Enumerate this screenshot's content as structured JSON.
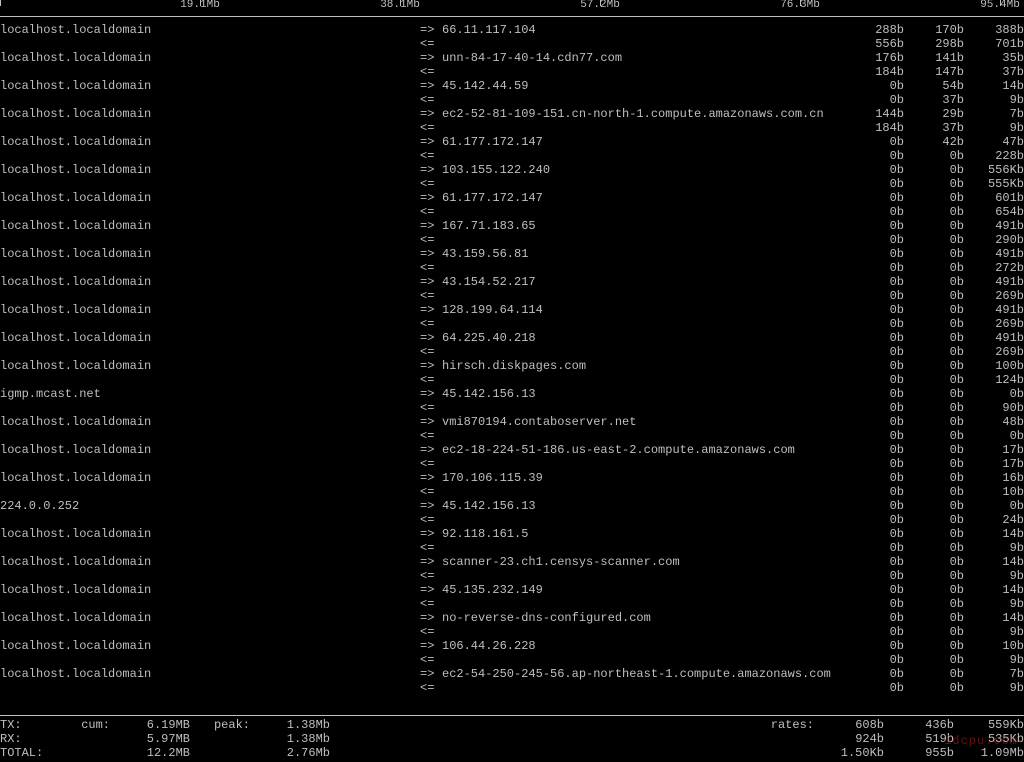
{
  "scale_ticks": [
    {
      "pos": 0,
      "label": ""
    },
    {
      "pos": 200,
      "label": "19.1Mb"
    },
    {
      "pos": 400,
      "label": "38.1Mb"
    },
    {
      "pos": 600,
      "label": "57.2Mb"
    },
    {
      "pos": 800,
      "label": "76.3Mb"
    },
    {
      "pos": 1000,
      "label": "95.4Mb"
    }
  ],
  "connections": [
    {
      "src": "localhost.localdomain",
      "dst": "66.11.117.104",
      "tx": [
        "288b",
        "170b",
        "388b"
      ],
      "rx": [
        "556b",
        "298b",
        "701b"
      ]
    },
    {
      "src": "localhost.localdomain",
      "dst": "unn-84-17-40-14.cdn77.com",
      "tx": [
        "176b",
        "141b",
        "35b"
      ],
      "rx": [
        "184b",
        "147b",
        "37b"
      ]
    },
    {
      "src": "localhost.localdomain",
      "dst": "45.142.44.59",
      "tx": [
        "0b",
        "54b",
        "14b"
      ],
      "rx": [
        "0b",
        "37b",
        "9b"
      ]
    },
    {
      "src": "localhost.localdomain",
      "dst": "ec2-52-81-109-151.cn-north-1.compute.amazonaws.com.cn",
      "tx": [
        "144b",
        "29b",
        "7b"
      ],
      "rx": [
        "184b",
        "37b",
        "9b"
      ]
    },
    {
      "src": "localhost.localdomain",
      "dst": "61.177.172.147",
      "tx": [
        "0b",
        "42b",
        "47b"
      ],
      "rx": [
        "0b",
        "0b",
        "228b"
      ]
    },
    {
      "src": "localhost.localdomain",
      "dst": "103.155.122.240",
      "tx": [
        "0b",
        "0b",
        "556Kb"
      ],
      "rx": [
        "0b",
        "0b",
        "555Kb"
      ]
    },
    {
      "src": "localhost.localdomain",
      "dst": "61.177.172.147",
      "tx": [
        "0b",
        "0b",
        "601b"
      ],
      "rx": [
        "0b",
        "0b",
        "654b"
      ]
    },
    {
      "src": "localhost.localdomain",
      "dst": "167.71.183.65",
      "tx": [
        "0b",
        "0b",
        "491b"
      ],
      "rx": [
        "0b",
        "0b",
        "290b"
      ]
    },
    {
      "src": "localhost.localdomain",
      "dst": "43.159.56.81",
      "tx": [
        "0b",
        "0b",
        "491b"
      ],
      "rx": [
        "0b",
        "0b",
        "272b"
      ]
    },
    {
      "src": "localhost.localdomain",
      "dst": "43.154.52.217",
      "tx": [
        "0b",
        "0b",
        "491b"
      ],
      "rx": [
        "0b",
        "0b",
        "269b"
      ]
    },
    {
      "src": "localhost.localdomain",
      "dst": "128.199.64.114",
      "tx": [
        "0b",
        "0b",
        "491b"
      ],
      "rx": [
        "0b",
        "0b",
        "269b"
      ]
    },
    {
      "src": "localhost.localdomain",
      "dst": "64.225.40.218",
      "tx": [
        "0b",
        "0b",
        "491b"
      ],
      "rx": [
        "0b",
        "0b",
        "269b"
      ]
    },
    {
      "src": "localhost.localdomain",
      "dst": "hirsch.diskpages.com",
      "tx": [
        "0b",
        "0b",
        "100b"
      ],
      "rx": [
        "0b",
        "0b",
        "124b"
      ]
    },
    {
      "src": "igmp.mcast.net",
      "dst": "45.142.156.13",
      "tx": [
        "0b",
        "0b",
        "0b"
      ],
      "rx": [
        "0b",
        "0b",
        "90b"
      ]
    },
    {
      "src": "localhost.localdomain",
      "dst": "vmi870194.contaboserver.net",
      "tx": [
        "0b",
        "0b",
        "48b"
      ],
      "rx": [
        "0b",
        "0b",
        "0b"
      ]
    },
    {
      "src": "localhost.localdomain",
      "dst": "ec2-18-224-51-186.us-east-2.compute.amazonaws.com",
      "tx": [
        "0b",
        "0b",
        "17b"
      ],
      "rx": [
        "0b",
        "0b",
        "17b"
      ]
    },
    {
      "src": "localhost.localdomain",
      "dst": "170.106.115.39",
      "tx": [
        "0b",
        "0b",
        "16b"
      ],
      "rx": [
        "0b",
        "0b",
        "10b"
      ]
    },
    {
      "src": "224.0.0.252",
      "dst": "45.142.156.13",
      "tx": [
        "0b",
        "0b",
        "0b"
      ],
      "rx": [
        "0b",
        "0b",
        "24b"
      ]
    },
    {
      "src": "localhost.localdomain",
      "dst": "92.118.161.5",
      "tx": [
        "0b",
        "0b",
        "14b"
      ],
      "rx": [
        "0b",
        "0b",
        "9b"
      ]
    },
    {
      "src": "localhost.localdomain",
      "dst": "scanner-23.ch1.censys-scanner.com",
      "tx": [
        "0b",
        "0b",
        "14b"
      ],
      "rx": [
        "0b",
        "0b",
        "9b"
      ]
    },
    {
      "src": "localhost.localdomain",
      "dst": "45.135.232.149",
      "tx": [
        "0b",
        "0b",
        "14b"
      ],
      "rx": [
        "0b",
        "0b",
        "9b"
      ]
    },
    {
      "src": "localhost.localdomain",
      "dst": "no-reverse-dns-configured.com",
      "tx": [
        "0b",
        "0b",
        "14b"
      ],
      "rx": [
        "0b",
        "0b",
        "9b"
      ]
    },
    {
      "src": "localhost.localdomain",
      "dst": "106.44.26.228",
      "tx": [
        "0b",
        "0b",
        "10b"
      ],
      "rx": [
        "0b",
        "0b",
        "9b"
      ]
    },
    {
      "src": "localhost.localdomain",
      "dst": "ec2-54-250-245-56.ap-northeast-1.compute.amazonaws.com",
      "tx": [
        "0b",
        "0b",
        "7b"
      ],
      "rx": [
        "0b",
        "0b",
        "9b"
      ]
    }
  ],
  "arrows": {
    "tx": "=>",
    "rx": "<="
  },
  "totals": {
    "tx": {
      "label": "TX:",
      "cum_label": "cum:",
      "cum": "6.19MB",
      "peak_label": "peak:",
      "peak": "1.38Mb",
      "rates_label": "rates:",
      "r": [
        "608b",
        "436b",
        "559Kb"
      ]
    },
    "rx": {
      "label": "RX:",
      "cum": "5.97MB",
      "peak": "1.38Mb",
      "r": [
        "924b",
        "519b",
        "535Kb"
      ]
    },
    "total": {
      "label": "TOTAL:",
      "cum": "12.2MB",
      "peak": "2.76Mb",
      "r": [
        "1.50Kb",
        "955b",
        "1.09Mb"
      ]
    }
  },
  "watermark": "idcpu.com"
}
